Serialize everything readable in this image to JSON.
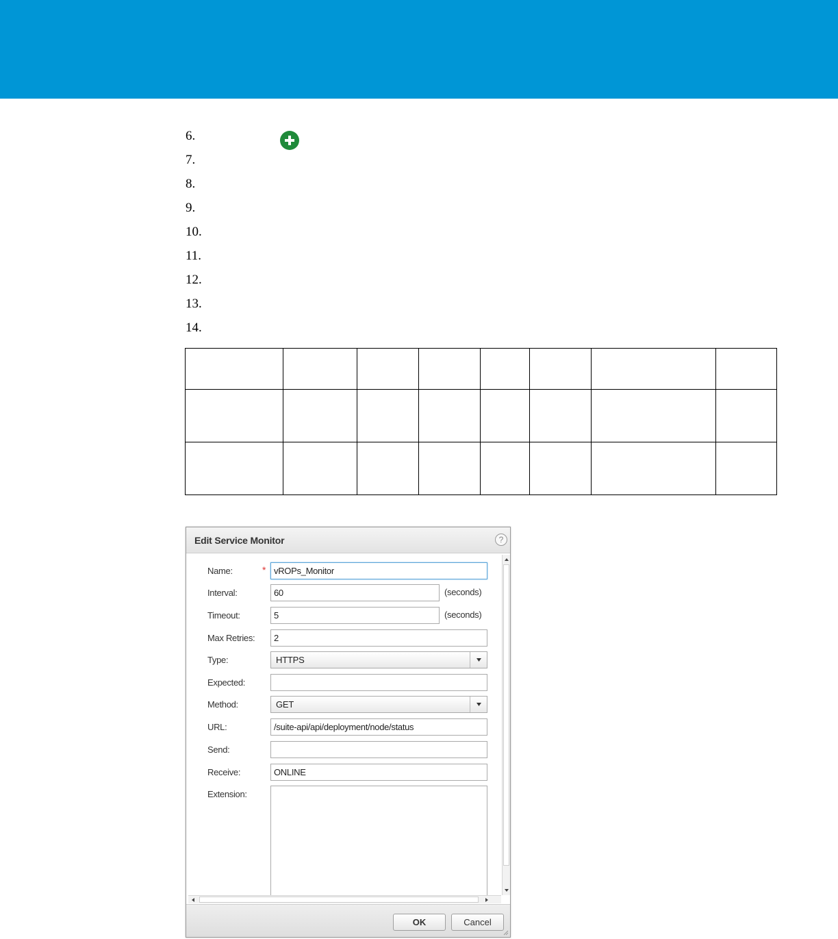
{
  "colors": {
    "banner": "#0096d6",
    "add_icon": "#1f8a3a"
  },
  "steps": [
    "6.",
    "7.",
    "8.",
    "9.",
    "10.",
    "11.",
    "12.",
    "13.",
    "14."
  ],
  "add_icon_name": "plus-circle-icon",
  "dialog": {
    "title": "Edit Service Monitor",
    "help_icon_label": "?",
    "fields": {
      "name": {
        "label": "Name:",
        "value": "vROPs_Monitor",
        "required_mark": "*"
      },
      "interval": {
        "label": "Interval:",
        "value": "60",
        "units": "(seconds)"
      },
      "timeout": {
        "label": "Timeout:",
        "value": "5",
        "units": "(seconds)"
      },
      "max_retries": {
        "label": "Max Retries:",
        "value": "2"
      },
      "type": {
        "label": "Type:",
        "value": "HTTPS"
      },
      "expected": {
        "label": "Expected:",
        "value": ""
      },
      "method": {
        "label": "Method:",
        "value": "GET"
      },
      "url": {
        "label": "URL:",
        "value": "/suite-api/api/deployment/node/status"
      },
      "send": {
        "label": "Send:",
        "value": ""
      },
      "receive": {
        "label": "Receive:",
        "value": "ONLINE"
      },
      "extension": {
        "label": "Extension:",
        "value": ""
      }
    },
    "buttons": {
      "ok": "OK",
      "cancel": "Cancel"
    }
  }
}
